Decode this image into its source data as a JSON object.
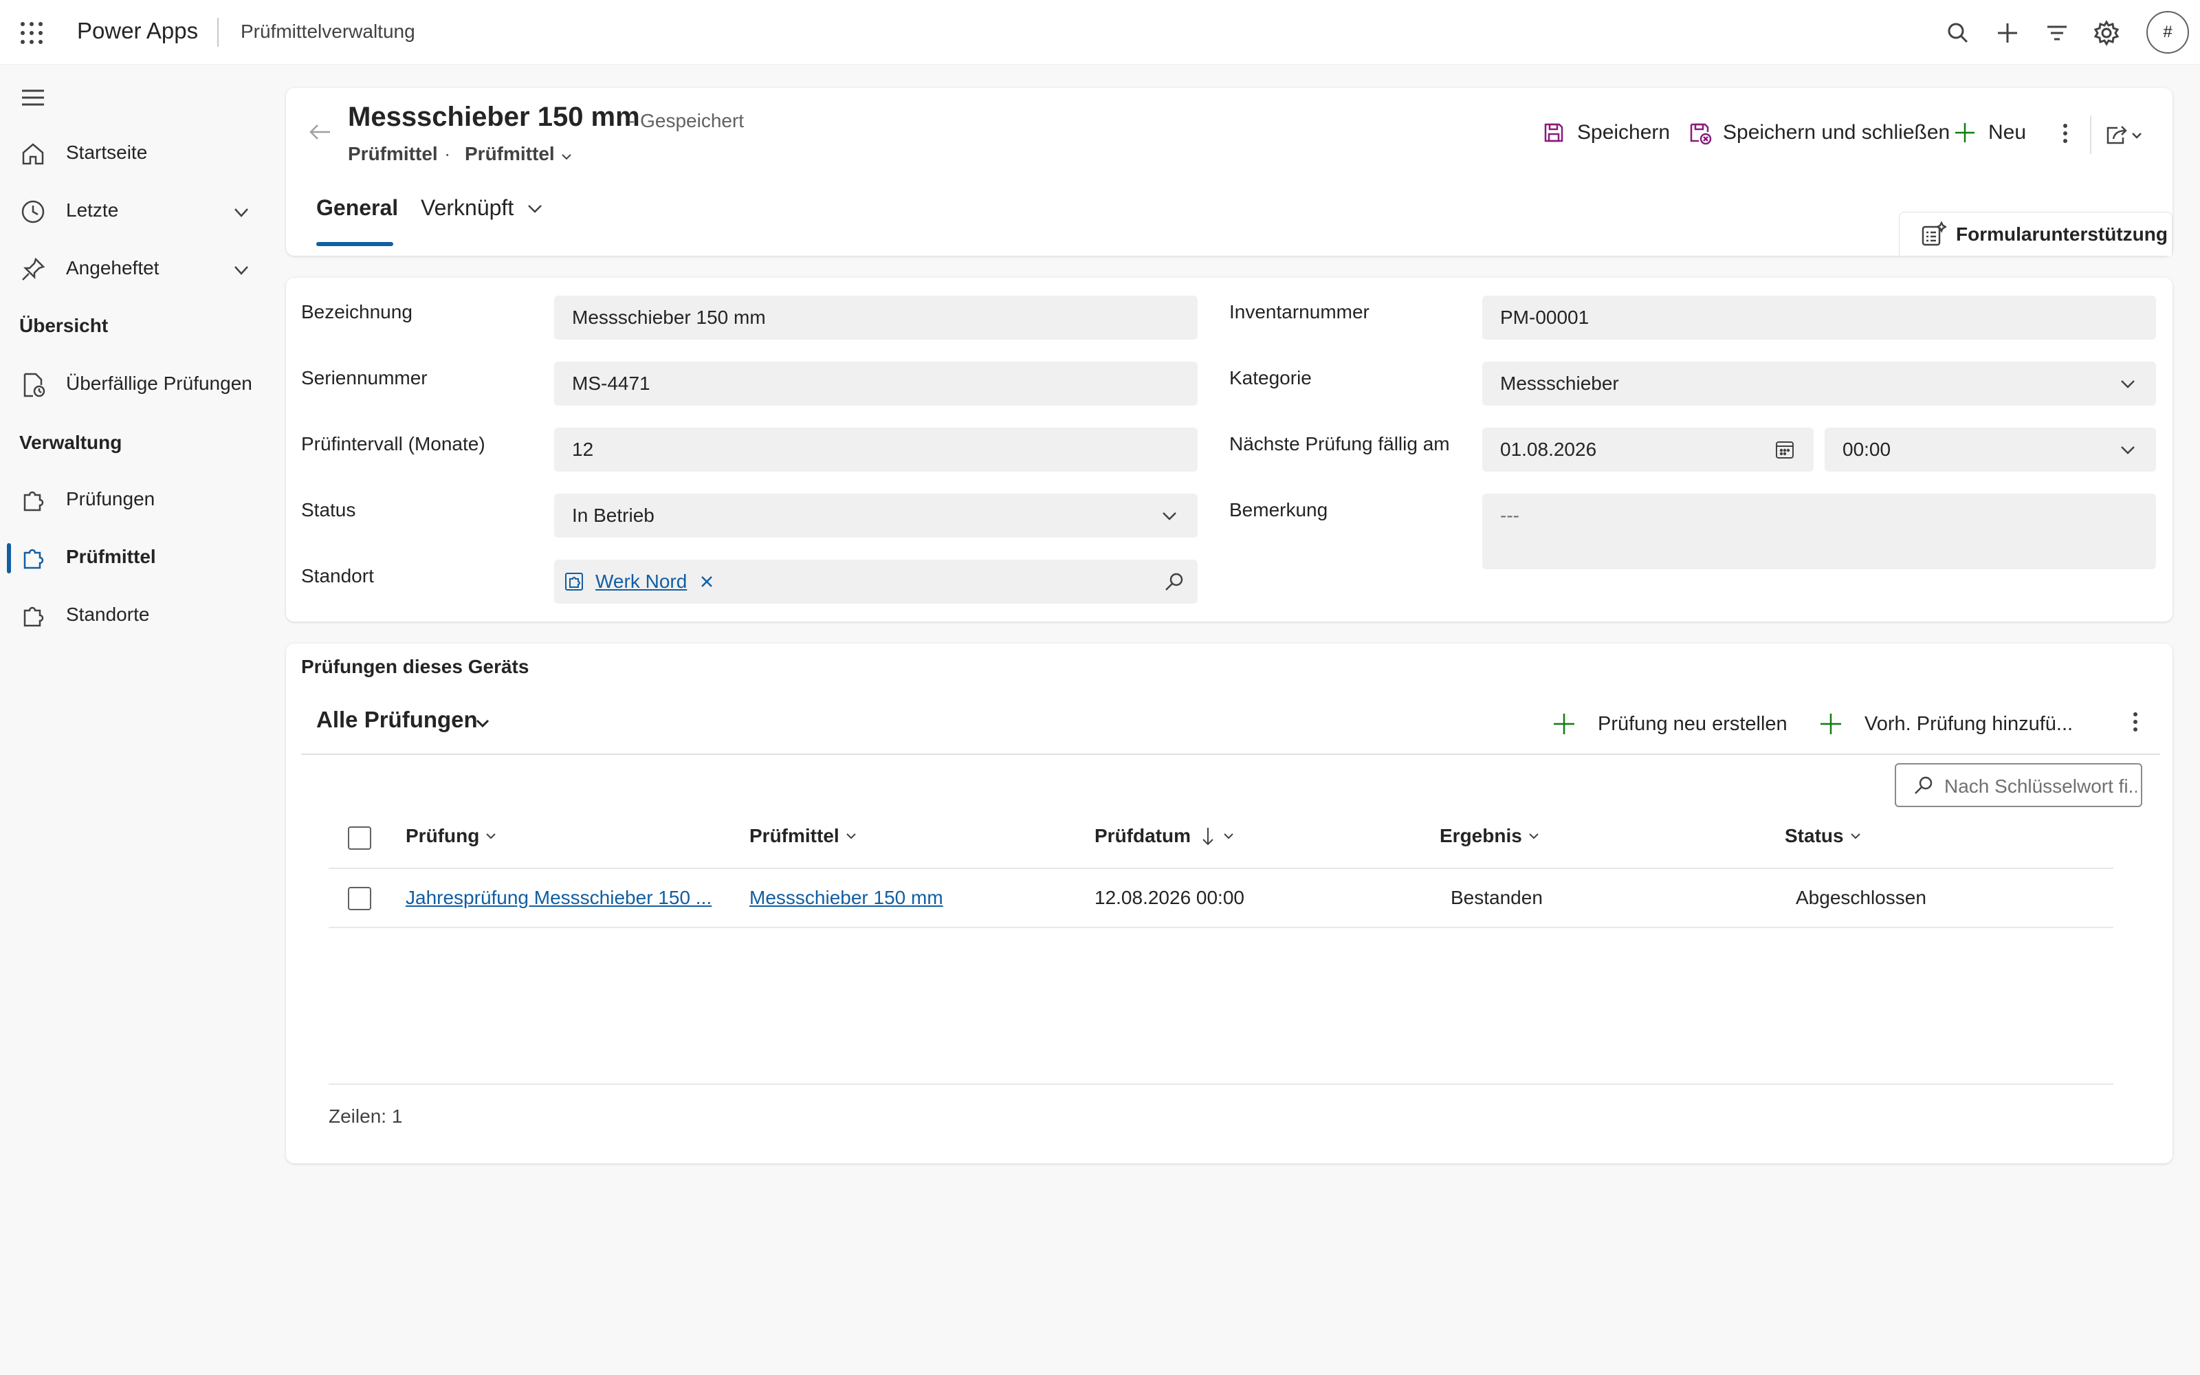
{
  "topbar": {
    "app_name": "Power Apps",
    "environment": "Prüfmittelverwaltung",
    "avatar_initials": "#",
    "icons": [
      "waffle-icon",
      "search-icon",
      "add-icon",
      "filter-icon",
      "settings-icon"
    ]
  },
  "sidebar": {
    "home": "Startseite",
    "recent": "Letzte",
    "pinned": "Angeheftet",
    "section_overview": "Übersicht",
    "overdue": "Überfällige Prüfungen",
    "section_admin": "Verwaltung",
    "inspections": "Prüfungen",
    "equipment": "Prüfmittel",
    "locations": "Standorte",
    "active_item": "Prüfmittel"
  },
  "record": {
    "title": "Messschieber 150 mm",
    "state": "- Gespeichert",
    "entity": "Prüfmittel",
    "separator": "·",
    "form_name": "Prüfmittel"
  },
  "commands": {
    "save": "Speichern",
    "save_close": "Speichern und schließen",
    "new": "Neu"
  },
  "tabs": {
    "general": "General",
    "related": "Verknüpft",
    "active": "General"
  },
  "form_assist": "Formularunterstützung",
  "form": {
    "designation_label": "Bezeichnung",
    "designation_value": "Messschieber 150 mm",
    "serial_label": "Seriennummer",
    "serial_value": "MS-4471",
    "interval_label": "Prüfintervall (Monate)",
    "interval_value": "12",
    "status_label": "Status",
    "status_value": "In Betrieb",
    "location_label": "Standort",
    "location_value": "Werk Nord",
    "inventory_label": "Inventarnummer",
    "inventory_value": "PM-00001",
    "category_label": "Kategorie",
    "category_value": "Messschieber",
    "next_due_label": "Nächste Prüfung fällig am",
    "next_due_date": "01.08.2026",
    "next_due_time": "00:00",
    "remark_label": "Bemerkung",
    "remark_placeholder": "---"
  },
  "subgrid": {
    "title": "Prüfungen dieses Geräts",
    "view_name": "Alle Prüfungen",
    "cmd_new": "Prüfung neu erstellen",
    "cmd_add_existing": "Vorh. Prüfung hinzufü...",
    "search_placeholder": "Nach Schlüsselwort fi...",
    "columns": [
      "Prüfung",
      "Prüfmittel",
      "Prüfdatum",
      "Ergebnis",
      "Status"
    ],
    "sorted_column": "Prüfdatum",
    "sort_direction": "descending",
    "rows": [
      {
        "inspection": "Jahresprüfung Messschieber 150 ...",
        "equipment": "Messschieber 150 mm",
        "date": "12.08.2026 00:00",
        "result": "Bestanden",
        "status": "Abgeschlossen"
      }
    ],
    "row_count": "Zeilen: 1"
  },
  "colors": {
    "accent": "#115ea3",
    "save_icon": "#8a1a7c",
    "add_icon": "#107c10",
    "background": "#f8f8f8"
  }
}
